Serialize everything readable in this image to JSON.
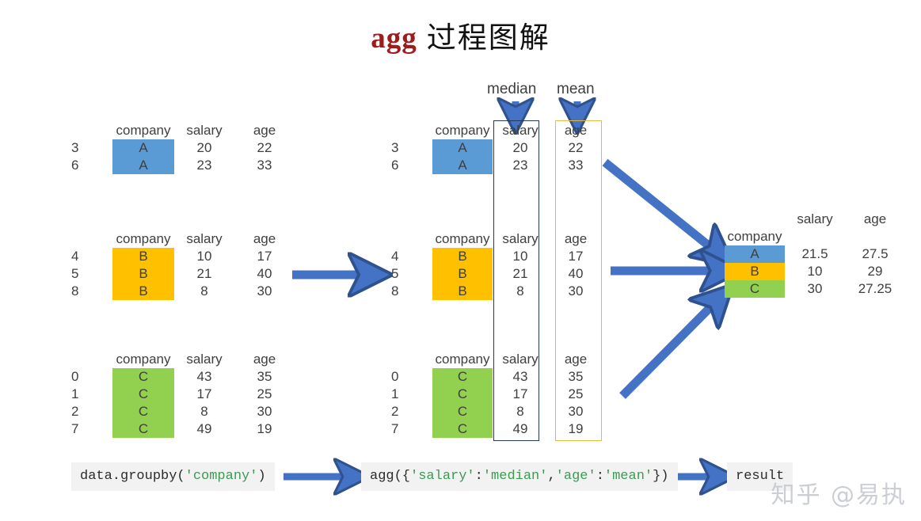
{
  "title": {
    "code_word": "agg",
    "chinese": "过程图解"
  },
  "colors": {
    "group_a": "#5b9bd5",
    "group_b": "#ffc000",
    "group_c": "#92d050",
    "arrow": "#4472c4",
    "arrow_stroke": "#2f528f",
    "salary_box_border": "#23395b",
    "age_box_border": "#e8b93c",
    "title_accent": "#a01b1b",
    "code_bg": "#f2f2f2",
    "code_string": "#3d9a52"
  },
  "headers": {
    "index": "",
    "company": "company",
    "salary": "salary",
    "age": "age"
  },
  "op_labels": {
    "median": "median",
    "mean": "mean"
  },
  "left_groups": [
    {
      "name": "group-a",
      "company": "A",
      "color": "#5b9bd5",
      "rows": [
        {
          "index": "3",
          "company": "A",
          "salary": "20",
          "age": "22"
        },
        {
          "index": "6",
          "company": "A",
          "salary": "23",
          "age": "33"
        }
      ]
    },
    {
      "name": "group-b",
      "company": "B",
      "color": "#ffc000",
      "rows": [
        {
          "index": "4",
          "company": "B",
          "salary": "10",
          "age": "17"
        },
        {
          "index": "5",
          "company": "B",
          "salary": "21",
          "age": "40"
        },
        {
          "index": "8",
          "company": "B",
          "salary": "8",
          "age": "30"
        }
      ]
    },
    {
      "name": "group-c",
      "company": "C",
      "color": "#92d050",
      "rows": [
        {
          "index": "0",
          "company": "C",
          "salary": "43",
          "age": "35"
        },
        {
          "index": "1",
          "company": "C",
          "salary": "17",
          "age": "25"
        },
        {
          "index": "2",
          "company": "C",
          "salary": "8",
          "age": "30"
        },
        {
          "index": "7",
          "company": "C",
          "salary": "49",
          "age": "19"
        }
      ]
    }
  ],
  "mid_groups": [
    {
      "name": "group-a",
      "company": "A",
      "color": "#5b9bd5",
      "rows": [
        {
          "index": "3",
          "company": "A",
          "salary": "20",
          "age": "22"
        },
        {
          "index": "6",
          "company": "A",
          "salary": "23",
          "age": "33"
        }
      ]
    },
    {
      "name": "group-b",
      "company": "B",
      "color": "#ffc000",
      "rows": [
        {
          "index": "4",
          "company": "B",
          "salary": "10",
          "age": "17"
        },
        {
          "index": "5",
          "company": "B",
          "salary": "21",
          "age": "40"
        },
        {
          "index": "8",
          "company": "B",
          "salary": "8",
          "age": "30"
        }
      ]
    },
    {
      "name": "group-c",
      "company": "C",
      "color": "#92d050",
      "rows": [
        {
          "index": "0",
          "company": "C",
          "salary": "43",
          "age": "35"
        },
        {
          "index": "1",
          "company": "C",
          "salary": "17",
          "age": "25"
        },
        {
          "index": "2",
          "company": "C",
          "salary": "8",
          "age": "30"
        },
        {
          "index": "7",
          "company": "C",
          "salary": "49",
          "age": "19"
        }
      ]
    }
  ],
  "result": {
    "headers": {
      "company": "company",
      "salary": "salary",
      "age": "age"
    },
    "rows": [
      {
        "company": "A",
        "salary": "21.5",
        "age": "27.5",
        "color": "#5b9bd5"
      },
      {
        "company": "B",
        "salary": "10",
        "age": "29",
        "color": "#ffc000"
      },
      {
        "company": "C",
        "salary": "30",
        "age": "27.25",
        "color": "#92d050"
      }
    ]
  },
  "code_steps": [
    {
      "name": "groupby",
      "parts": [
        {
          "t": "data.groupby(",
          "s": false
        },
        {
          "t": "'company'",
          "s": true
        },
        {
          "t": ")",
          "s": false
        }
      ]
    },
    {
      "name": "agg",
      "parts": [
        {
          "t": "agg({",
          "s": false
        },
        {
          "t": "'salary'",
          "s": true
        },
        {
          "t": ":",
          "s": false
        },
        {
          "t": "'median'",
          "s": true
        },
        {
          "t": ",",
          "s": false
        },
        {
          "t": "'age'",
          "s": true
        },
        {
          "t": ":",
          "s": false
        },
        {
          "t": "'mean'",
          "s": true
        },
        {
          "t": "})",
          "s": false
        }
      ]
    },
    {
      "name": "result",
      "parts": [
        {
          "t": "result",
          "s": false
        }
      ]
    }
  ],
  "watermark": "知乎 @易执"
}
